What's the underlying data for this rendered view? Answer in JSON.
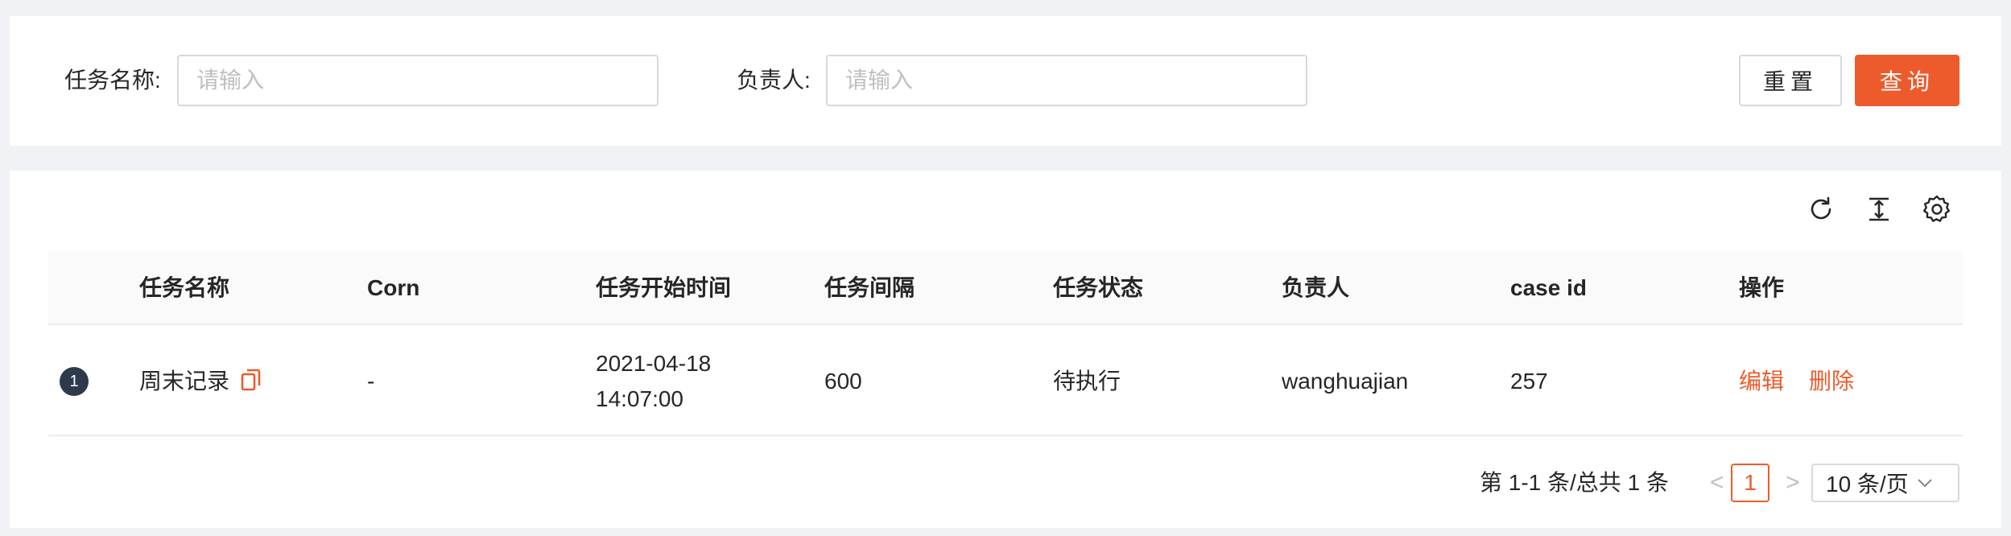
{
  "search": {
    "task_name_label": "任务名称:",
    "task_name_placeholder": "请输入",
    "owner_label": "负责人:",
    "owner_placeholder": "请输入",
    "reset_label": "重置",
    "query_label": "查询"
  },
  "toolbar": {
    "icons": [
      "refresh-icon",
      "column-height-icon",
      "settings-icon"
    ]
  },
  "table": {
    "columns": [
      "任务名称",
      "Corn",
      "任务开始时间",
      "任务间隔",
      "任务状态",
      "负责人",
      "case id",
      "操作"
    ],
    "rows": [
      {
        "index": "1",
        "task_name": "周末记录",
        "corn": "-",
        "start_date": "2021-04-18",
        "start_time": "14:07:00",
        "interval": "600",
        "status": "待执行",
        "owner": "wanghuajian",
        "case_id": "257",
        "action_edit": "编辑",
        "action_delete": "删除"
      }
    ]
  },
  "pagination": {
    "summary": "第 1-1 条/总共 1 条",
    "current_page": "1",
    "page_size": "10 条/页",
    "prev_symbol": "<",
    "next_symbol": ">"
  },
  "colors": {
    "accent": "#ed5b2d",
    "badge": "#2e3a4c"
  }
}
